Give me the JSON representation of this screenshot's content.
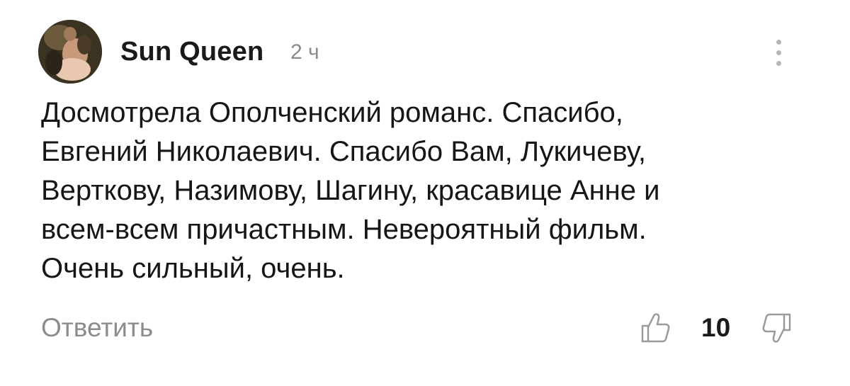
{
  "comment": {
    "author": "Sun Queen",
    "time": "2 ч",
    "text": "Досмотрела Ополченский романс. Спасибо,\nЕвгений Николаевич. Спасибо Вам, Лукичеву,\nВерткову, Назимову, Шагину, красавице Анне и\nвсем-всем причастным. Невероятный фильм.\nОчень сильный, очень.",
    "reply_label": "Ответить",
    "likes": "10"
  },
  "icons": {
    "avatar": "avatar-image",
    "more": "more-vertical-icon",
    "like": "thumbs-up-icon",
    "dislike": "thumbs-down-icon"
  },
  "colors": {
    "text": "#161616",
    "muted": "#8c8c8c",
    "icon": "#9a9a9a"
  }
}
